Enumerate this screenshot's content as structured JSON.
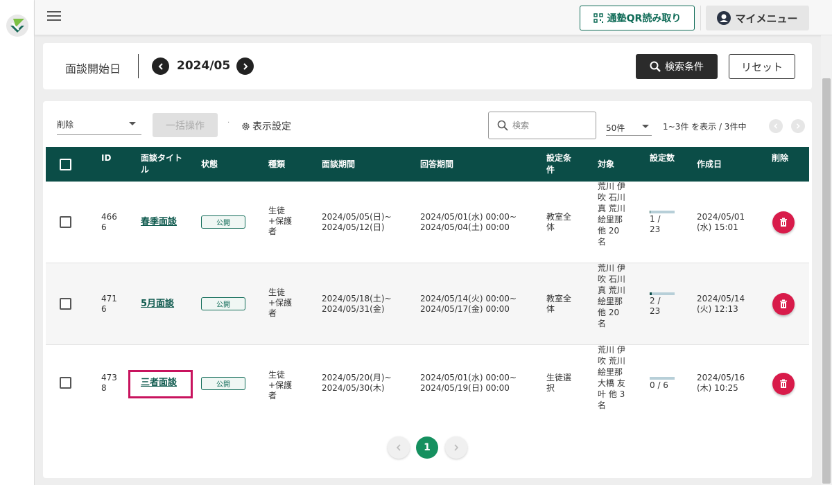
{
  "topbar": {
    "qr_button": "通塾QR読み取り",
    "my_menu": "マイメニュー"
  },
  "filter": {
    "date_label": "面談開始日",
    "date_value": "2024/05",
    "search_button": "検索条件",
    "reset_button": "リセット"
  },
  "toolbar": {
    "bulk_select_value": "削除",
    "bulk_button": "一括操作",
    "display_settings": "表示設定",
    "search_placeholder": "検索",
    "per_page": "50件",
    "range_text": "1~3件 を表示 / 3件中"
  },
  "table": {
    "headers": {
      "id": "ID",
      "title": "面談タイトル",
      "status": "状態",
      "type": "種類",
      "interview_period": "面談期間",
      "answer_period": "回答期間",
      "condition": "設定条件",
      "target": "対象",
      "count": "設定数",
      "created": "作成日",
      "delete": "削除"
    },
    "rows": [
      {
        "id": "4666",
        "title": "春季面談",
        "status": "公開",
        "type": "生徒+保護者",
        "interview_start": "2024/05/05(日)~",
        "interview_end": "2024/05/12(日)",
        "answer_start": "2024/05/01(水) 00:00~",
        "answer_end": "2024/05/04(土) 00:00",
        "condition": "教室全体",
        "target": "荒川 伊吹 石川 真 荒川 絵里那 他 20 名",
        "count": "1 / 23",
        "progress": 0.04,
        "created_date": "2024/05/01",
        "created_time": "(水) 15:01"
      },
      {
        "id": "4716",
        "title": "5月面談",
        "status": "公開",
        "type": "生徒+保護者",
        "interview_start": "2024/05/18(土)~",
        "interview_end": "2024/05/31(金)",
        "answer_start": "2024/05/14(火) 00:00~",
        "answer_end": "2024/05/17(金) 00:00",
        "condition": "教室全体",
        "target": "荒川 伊吹 石川 真 荒川 絵里那 他 20 名",
        "count": "2 / 23",
        "progress": 0.09,
        "created_date": "2024/05/14",
        "created_time": "(火) 12:13"
      },
      {
        "id": "4738",
        "title": "三者面談",
        "status": "公開",
        "type": "生徒+保護者",
        "interview_start": "2024/05/20(月)~",
        "interview_end": "2024/05/30(木)",
        "answer_start": "2024/05/01(水) 00:00~",
        "answer_end": "2024/05/19(日) 00:00",
        "condition": "生徒選択",
        "target": "荒川 伊吹 荒川 絵里那 大橋 友叶 他 3名",
        "count": "0 / 6",
        "progress": 0,
        "created_date": "2024/05/16",
        "created_time": "(木) 10:25"
      }
    ]
  },
  "pagination": {
    "current": "1"
  },
  "colors": {
    "primary": "#0b4d47",
    "accent_green": "#15905f",
    "delete_red": "#d81b4a",
    "highlight": "#c8135e"
  }
}
